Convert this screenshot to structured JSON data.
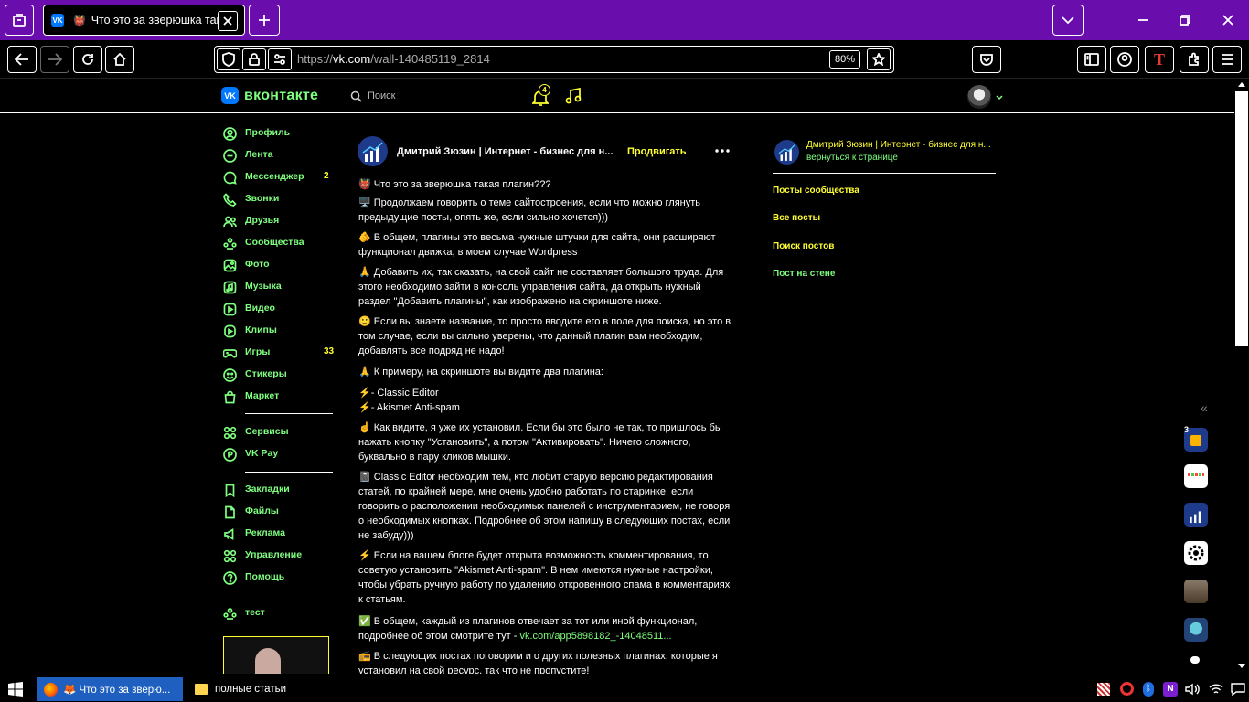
{
  "browser": {
    "tab_title": "Что это за зверюшка така",
    "url_prefix": "https://",
    "url_domain": "vk.com",
    "url_path": "/wall-140485119_2814",
    "zoom": "80%"
  },
  "vk": {
    "logo_text": "вконтакте",
    "search_placeholder": "Поиск",
    "notification_count": "4"
  },
  "nav": {
    "items": [
      {
        "label": "Профиль",
        "icon": "profile-icon"
      },
      {
        "label": "Лента",
        "icon": "feed-icon"
      },
      {
        "label": "Мессенджер",
        "icon": "messenger-icon",
        "count": "2"
      },
      {
        "label": "Звонки",
        "icon": "phone-icon"
      },
      {
        "label": "Друзья",
        "icon": "friends-icon"
      },
      {
        "label": "Сообщества",
        "icon": "communities-icon"
      },
      {
        "label": "Фото",
        "icon": "photo-icon"
      },
      {
        "label": "Музыка",
        "icon": "music-icon"
      },
      {
        "label": "Видео",
        "icon": "video-icon"
      },
      {
        "label": "Клипы",
        "icon": "clips-icon"
      },
      {
        "label": "Игры",
        "icon": "games-icon",
        "count": "33"
      },
      {
        "label": "Стикеры",
        "icon": "stickers-icon"
      },
      {
        "label": "Маркет",
        "icon": "market-icon"
      }
    ],
    "items2": [
      {
        "label": "Сервисы",
        "icon": "services-icon"
      },
      {
        "label": "VK Pay",
        "icon": "vkpay-icon"
      }
    ],
    "items3": [
      {
        "label": "Закладки",
        "icon": "bookmark-icon"
      },
      {
        "label": "Файлы",
        "icon": "files-icon"
      },
      {
        "label": "Реклама",
        "icon": "ads-icon"
      },
      {
        "label": "Управление",
        "icon": "manage-icon"
      },
      {
        "label": "Помощь",
        "icon": "help-icon"
      }
    ],
    "items4": [
      {
        "label": "тест",
        "icon": "group-icon"
      }
    ]
  },
  "post": {
    "author": "Дмитрий Зюзин | Интернет - бизнес для н...",
    "promote": "Продвигать",
    "paragraphs": [
      "👹 Что это за зверюшка такая плагин???",
      "🖥️ Продолжаем говорить о теме сайтостроения, если что можно глянуть предыдущие посты, опять же, если сильно хочется)))",
      "🫵 В общем, плагины это весьма нужные штучки для сайта, они расширяют функционал движка, в моем случае Wordpress",
      "🙏 Добавить их, так сказать, на свой сайт не составляет большого труда. Для этого необходимо зайти в консоль управления сайта, да открыть нужный раздел \"Добавить плагины\", как изображено на скриншоте ниже.",
      "🙂 Если вы знаете название, то просто вводите его в поле для поиска, но это в том случае, если вы сильно уверены, что данный плагин вам необходим, добавлять все подряд не надо!",
      "🙏 К примеру, на скриншоте вы видите два плагина:",
      "⚡- Classic Editor\n⚡- Akismet Anti-spam",
      "☝️ Как видите, я уже их установил. Если бы это было не так, то пришлось бы нажать кнопку \"Установить\", а потом \"Активировать\". Ничего сложного, буквально в пару кликов мышки.",
      "📓 Classic Editor необходим тем, кто любит старую версию редактирования статей, по крайней мере, мне очень удобно работать по старинке, если говорить о расположении необходимых панелей с инструментарием, не говоря о необходимых кнопках. Подробнее об этом напишу в следующих постах, если не забуду)))",
      "⚡ Если на вашем блоге будет открыта возможность комментирования, то советую установить \"Akismet Anti-spam\". В нем имеются нужные настройки, чтобы убрать ручную работу по удалению откровенного спама в комментариях к статьям.",
      "✅ В общем, каждый из плагинов отвечает за тот или иной функционал, подробнее об этом смотрите тут - ",
      "📻 В следующих постах поговорим и о других полезных плагинах, которые я установил на свой ресурс, так что не пропустите!"
    ],
    "link_text": "vk.com/app5898182_-14048511..."
  },
  "right": {
    "community": "Дмитрий Зюзин | Интернет - бизнес для н...",
    "back": "вернуться к странице",
    "links": [
      "Посты сообщества",
      "Все посты",
      "Поиск постов",
      "Пост на стене"
    ]
  },
  "sidebar_badge": "3",
  "taskbar": {
    "firefox_item": "Что это за зверю...",
    "folder_item": "полные статьи"
  }
}
